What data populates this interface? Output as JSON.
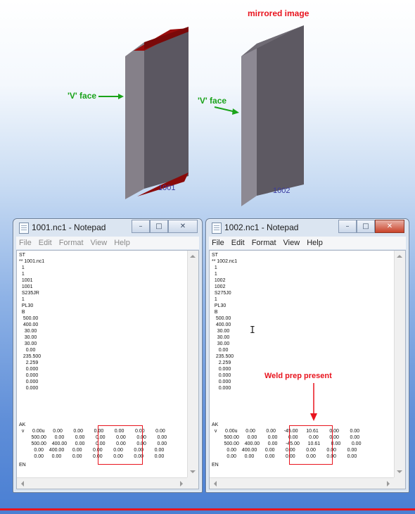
{
  "scene": {
    "mirrored_label": "mirrored image",
    "v_face_left": "'V' face",
    "v_face_right": "'V' face",
    "plate1_label": "1001",
    "plate2_label": "1002",
    "colors": {
      "plate_face": "#8a8690",
      "plate_side": "#5d5962",
      "bevel": "#9a0c0c",
      "annotation_red": "#e8141e",
      "annotation_green": "#1aa31a"
    }
  },
  "window1": {
    "title": "1001.nc1 - Notepad",
    "menu": [
      "File",
      "Edit",
      "Format",
      "View",
      "Help"
    ],
    "lines": [
      "ST",
      "** 1001.nc1",
      "  1",
      "  1",
      "  1001",
      "  1001",
      "  S235JR",
      "  1",
      "  PL30",
      "  B",
      "   500.00",
      "   400.00",
      "    30.00",
      "    30.00",
      "    30.00",
      "     0.00",
      "   235.500",
      "     2.259",
      "     0.000",
      "     0.000",
      "     0.000",
      "     0.000"
    ],
    "ak_lines": [
      "AK",
      "  v      0.00u      0.00        0.00        0.00        0.00        0.00        0.00",
      "         500.00      0.00        0.00        0.00        0.00        0.00        0.00",
      "         500.00    400.00      0.00        0.00        0.00        0.00        0.00",
      "           0.00    400.00      0.00        0.00        0.00        0.00        0.00",
      "           0.00      0.00        0.00        0.00        0.00        0.00        0.00",
      "EN"
    ]
  },
  "window2": {
    "title": "1002.nc1 - Notepad",
    "menu": [
      "File",
      "Edit",
      "Format",
      "View",
      "Help"
    ],
    "lines": [
      "ST",
      "** 1002.nc1",
      "  1",
      "  1",
      "  1002",
      "  1002",
      "  S275J0",
      "  1",
      "  PL30",
      "  B",
      "   500.00",
      "   400.00",
      "    30.00",
      "    30.00",
      "    30.00",
      "     0.00",
      "   235.500",
      "     2.259",
      "     0.000",
      "     0.000",
      "     0.000",
      "     0.000"
    ],
    "ak_lines": [
      "AK",
      "  v      0.00u      0.00        0.00      -45.00      10.61        0.00        0.00",
      "         500.00      0.00        0.00        0.00        0.00        0.00        0.00",
      "         500.00    400.00      0.00      -45.00      10.61        0.00        0.00",
      "           0.00    400.00      0.00        0.00        0.00        0.00        0.00",
      "           0.00      0.00        0.00        0.00        0.00        0.00        0.00",
      "EN"
    ],
    "annotation": "Weld prep present"
  },
  "caption_buttons": {
    "minimize": "–",
    "maximize": "□",
    "close": "✕"
  }
}
